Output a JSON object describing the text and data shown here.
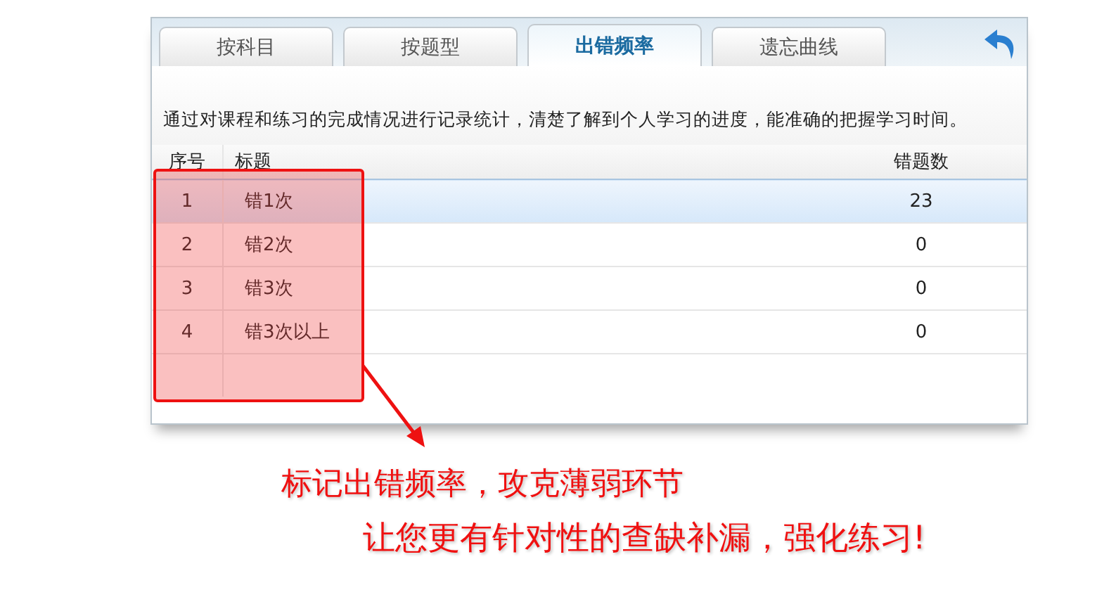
{
  "tabs": [
    {
      "label": "按科目",
      "selected": false
    },
    {
      "label": "按题型",
      "selected": false
    },
    {
      "label": "出错频率",
      "selected": true
    },
    {
      "label": "遗忘曲线",
      "selected": false
    }
  ],
  "description": "通过对课程和练习的完成情况进行记录统计，清楚了解到个人学习的进度，能准确的把握学习时间。",
  "table": {
    "columns": [
      "序号",
      "标题",
      "错题数"
    ],
    "rows": [
      {
        "cells": [
          "1",
          "错1次",
          "23"
        ],
        "selected": true
      },
      {
        "cells": [
          "2",
          "错2次",
          "0"
        ],
        "selected": false
      },
      {
        "cells": [
          "3",
          "错3次",
          "0"
        ],
        "selected": false
      },
      {
        "cells": [
          "4",
          "错3次以上",
          "0"
        ],
        "selected": false
      }
    ]
  },
  "callout": [
    "标记出错频率，攻克薄弱环节",
    "让您更有针对性的查缺补漏，强化练习!"
  ]
}
